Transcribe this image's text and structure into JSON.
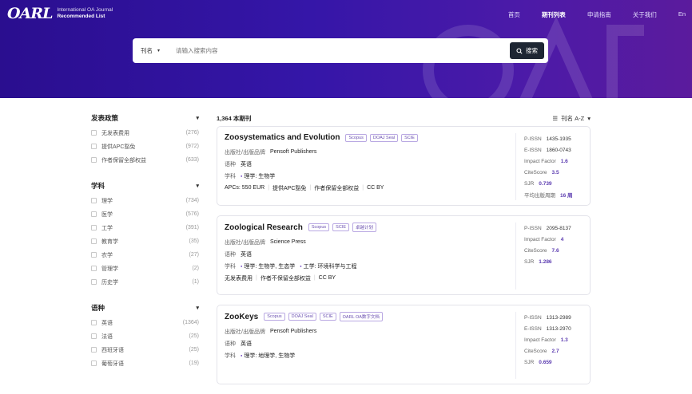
{
  "header": {
    "logo_mark": "OARL",
    "logo_line1": "International OA Journal",
    "logo_line2": "Recommended List",
    "nav": [
      "首页",
      "期刊列表",
      "申请指南",
      "关于我们",
      "En"
    ],
    "active_nav": "期刊列表"
  },
  "search": {
    "category": "刊名",
    "placeholder": "请输入搜索内容",
    "button": "搜索"
  },
  "filters": [
    {
      "title": "发表政策",
      "options": [
        {
          "name": "无发表费用",
          "count": "(276)"
        },
        {
          "name": "提供APC豁免",
          "count": "(972)"
        },
        {
          "name": "作者保留全部权益",
          "count": "(633)"
        }
      ]
    },
    {
      "title": "学科",
      "options": [
        {
          "name": "理学",
          "count": "(734)"
        },
        {
          "name": "医学",
          "count": "(576)"
        },
        {
          "name": "工学",
          "count": "(391)"
        },
        {
          "name": "教育学",
          "count": "(35)"
        },
        {
          "name": "农学",
          "count": "(27)"
        },
        {
          "name": "管理学",
          "count": "(2)"
        },
        {
          "name": "历史学",
          "count": "(1)"
        }
      ]
    },
    {
      "title": "语种",
      "options": [
        {
          "name": "英语",
          "count": "(1364)"
        },
        {
          "name": "法语",
          "count": "(25)"
        },
        {
          "name": "西班牙语",
          "count": "(25)"
        },
        {
          "name": "葡萄牙语",
          "count": "(19)"
        }
      ]
    }
  ],
  "results": {
    "count": "1,364 本期刊",
    "sort": "刊名 A-Z"
  },
  "labels": {
    "publisher": "出版社/出版品牌",
    "language": "语种",
    "subject": "学科"
  },
  "journals": [
    {
      "title": "Zoosystematics and Evolution",
      "tags": [
        "Scopus",
        "DOAJ Seal",
        "SCIE"
      ],
      "publisher": "Pensoft Publishers",
      "language": "英语",
      "subjects": [
        "理学: 生物学"
      ],
      "policy": [
        "APCs: 550 EUR",
        "提供APC豁免",
        "作者保留全部权益",
        "CC BY"
      ],
      "metrics": [
        {
          "k": "P-ISSN",
          "v": "1435-1935",
          "hl": false
        },
        {
          "k": "E-ISSN",
          "v": "1860-0743",
          "hl": false
        },
        {
          "k": "Impact Factor",
          "v": "1.6",
          "hl": true
        },
        {
          "k": "CiteScore",
          "v": "3.5",
          "hl": true
        },
        {
          "k": "SJR",
          "v": "0.739",
          "hl": true
        },
        {
          "k": "平均出版周期",
          "v": "16 周",
          "hl": true
        }
      ]
    },
    {
      "title": "Zoological Research",
      "tags": [
        "Scopus",
        "SCIE",
        "卓越计划"
      ],
      "publisher": "Science Press",
      "language": "英语",
      "subjects": [
        "理学: 生物学, 生态学",
        "工学: 环境科学与工程"
      ],
      "policy": [
        "无发表费用",
        "作者不保留全部权益",
        "CC BY"
      ],
      "metrics": [
        {
          "k": "P-ISSN",
          "v": "2095-8137",
          "hl": false
        },
        {
          "k": "Impact Factor",
          "v": "4",
          "hl": true
        },
        {
          "k": "CiteScore",
          "v": "7.6",
          "hl": true
        },
        {
          "k": "SJR",
          "v": "1.286",
          "hl": true
        }
      ]
    },
    {
      "title": "ZooKeys",
      "tags": [
        "Scopus",
        "DOAJ Seal",
        "SCIE",
        "OARL OA数字文档"
      ],
      "publisher": "Pensoft Publishers",
      "language": "英语",
      "subjects": [
        "理学: 地理学, 生物学"
      ],
      "policy": [],
      "metrics": [
        {
          "k": "P-ISSN",
          "v": "1313-2989",
          "hl": false
        },
        {
          "k": "E-ISSN",
          "v": "1313-2970",
          "hl": false
        },
        {
          "k": "Impact Factor",
          "v": "1.3",
          "hl": true
        },
        {
          "k": "CiteScore",
          "v": "2.7",
          "hl": true
        },
        {
          "k": "SJR",
          "v": "0.659",
          "hl": true
        }
      ]
    }
  ]
}
